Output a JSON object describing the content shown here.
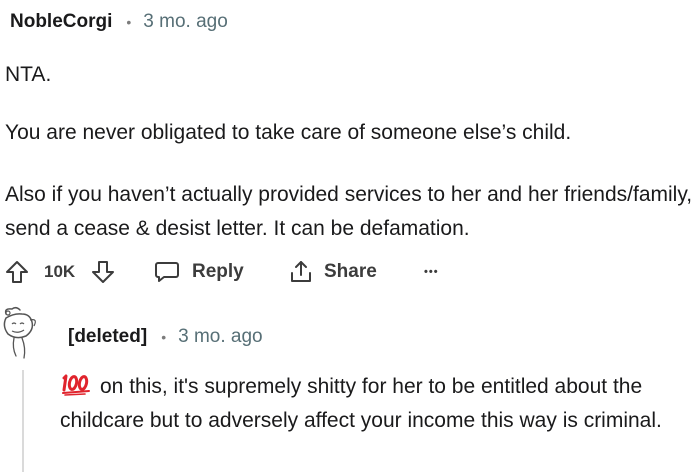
{
  "comment": {
    "author": "NobleCorgi",
    "separator": "•",
    "time": "3 mo. ago",
    "paragraphs": [
      "NTA.",
      "You are never obligated to take care of someone else’s child.",
      "Also if you haven’t actually provided services to her and her friends/family, send a cease & desist letter. It can be defamation."
    ],
    "actions": {
      "upvote_icon": "arrow-up-outline-icon",
      "vote_count": "10K",
      "downvote_icon": "arrow-down-outline-icon",
      "reply_icon": "speech-bubble-icon",
      "reply_label": "Reply",
      "share_icon": "share-upload-icon",
      "share_label": "Share",
      "more_label": "•••"
    }
  },
  "reply": {
    "avatar_icon": "deleted-user-avatar-icon",
    "author": "[deleted]",
    "separator": "•",
    "time": "3 mo. ago",
    "emoji_icon": "hundred-points-emoji-icon",
    "text": "on this, it's supremely shitty for her to be entitled about the childcare but to adversely affect your income this way is criminal."
  },
  "colors": {
    "text": "#1a1a1b",
    "meta": "#576f76",
    "action": "#3c3c3c",
    "emoji_red": "#e0242d",
    "thread_line": "#dadada"
  }
}
